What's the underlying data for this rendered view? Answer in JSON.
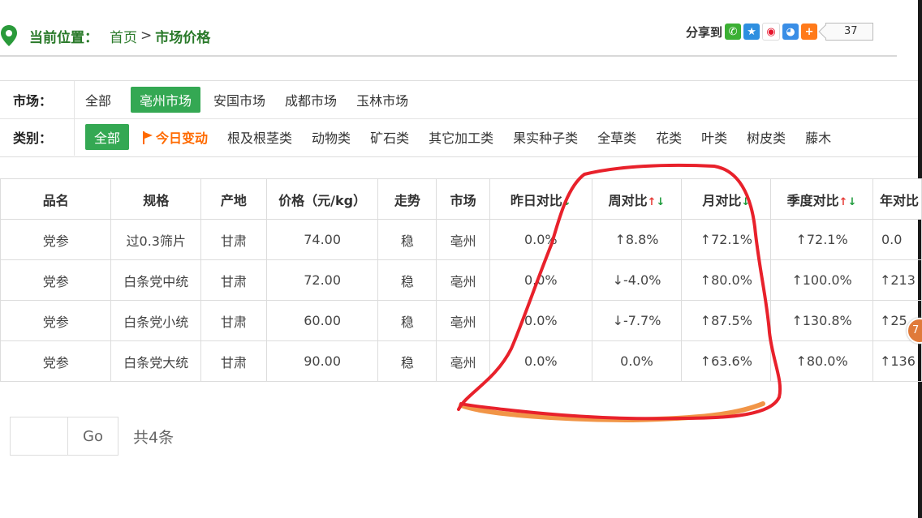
{
  "breadcrumb": {
    "label": "当前位置：",
    "home": "首页",
    "separator": ">",
    "current": "市场价格"
  },
  "share": {
    "label": "分享到",
    "count": "37",
    "icons": [
      "wechat-icon",
      "qzone-icon",
      "weibo-icon",
      "qq-icon",
      "more-share-icon"
    ]
  },
  "filters": {
    "market": {
      "label": "市场：",
      "items": [
        "全部",
        "亳州市场",
        "安国市场",
        "成都市场",
        "玉林市场"
      ],
      "active": "亳州市场"
    },
    "category": {
      "label": "类别：",
      "items": [
        "全部",
        "今日变动",
        "根及根茎类",
        "动物类",
        "矿石类",
        "其它加工类",
        "果实种子类",
        "全草类",
        "花类",
        "叶类",
        "树皮类",
        "藤木"
      ],
      "active": "全部"
    }
  },
  "table": {
    "headers": [
      "品名",
      "规格",
      "产地",
      "价格（元/kg）",
      "走势",
      "市场",
      "昨日对比",
      "周对比",
      "月对比",
      "季度对比",
      "年对比"
    ],
    "rows": [
      {
        "name": "党参",
        "spec": "过0.3筛片",
        "origin": "甘肃",
        "price": "74.00",
        "trend": "稳",
        "market": "亳州",
        "day": "0.0%",
        "week": "↑8.8%",
        "month": "↑72.1%",
        "quarter": "↑72.1%",
        "year": "0.0"
      },
      {
        "name": "党参",
        "spec": "白条党中统",
        "origin": "甘肃",
        "price": "72.00",
        "trend": "稳",
        "market": "亳州",
        "day": "0.0%",
        "week": "↓-4.0%",
        "month": "↑80.0%",
        "quarter": "↑100.0%",
        "year": "↑213"
      },
      {
        "name": "党参",
        "spec": "白条党小统",
        "origin": "甘肃",
        "price": "60.00",
        "trend": "稳",
        "market": "亳州",
        "day": "0.0%",
        "week": "↓-7.7%",
        "month": "↑87.5%",
        "quarter": "↑130.8%",
        "year": "↑25"
      },
      {
        "name": "党参",
        "spec": "白条党大统",
        "origin": "甘肃",
        "price": "90.00",
        "trend": "稳",
        "market": "亳州",
        "day": "0.0%",
        "week": "0.0%",
        "month": "↑63.6%",
        "quarter": "↑80.0%",
        "year": "↑136"
      }
    ]
  },
  "pagination": {
    "go_label": "Go",
    "total": "共4条"
  },
  "float_badge": "7",
  "colors": {
    "accent_green": "#34a853",
    "up": "#ff6a00",
    "down": "#1c9a3a",
    "annotation_red": "#e8212b",
    "annotation_orange": "#ef8a33"
  }
}
